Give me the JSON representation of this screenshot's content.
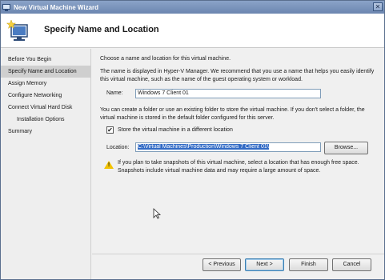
{
  "window": {
    "title": "New Virtual Machine Wizard",
    "close_glyph": "✕",
    "title_icon": "vm-wizard-icon"
  },
  "header": {
    "title": "Specify Name and Location",
    "icon": "monitor-with-star-icon"
  },
  "nav": {
    "items": [
      {
        "label": "Before You Begin"
      },
      {
        "label": "Specify Name and Location",
        "active": true
      },
      {
        "label": "Assign Memory"
      },
      {
        "label": "Configure Networking"
      },
      {
        "label": "Connect Virtual Hard Disk"
      },
      {
        "label": "Installation Options",
        "sub": true
      },
      {
        "label": "Summary"
      }
    ]
  },
  "content": {
    "intro": "Choose a name and location for this virtual machine.",
    "name_help": "The name is displayed in Hyper-V Manager. We recommend that you use a name that helps you easily identify this virtual machine, such as the name of the guest operating system or workload.",
    "name_label": "Name:",
    "name_value": "Windows 7 Client 01",
    "folder_help": "You can create a folder or use an existing folder to store the virtual machine. If you don't select a folder, the virtual machine is stored in the default folder configured for this server.",
    "store_checkbox_label": "Store the virtual machine in a different location",
    "store_checked": true,
    "check_glyph": "✔",
    "location_label": "Location:",
    "location_value": "C:\\Virtual Machines\\Production\\Windows 7 Client 01\\",
    "browse_label": "Browse...",
    "warning_icon": "warning-icon",
    "warning_mark": "!",
    "warning_text": "If you plan to take snapshots of this virtual machine, select a location that has enough free space. Snapshots include virtual machine data and may require a large amount of space."
  },
  "footer": {
    "previous_label": "< Previous",
    "next_label": "Next >",
    "finish_label": "Finish",
    "cancel_label": "Cancel"
  },
  "colors": {
    "titlebar": "#7a93bd",
    "selection": "#316ac5",
    "warning": "#f2c200"
  }
}
